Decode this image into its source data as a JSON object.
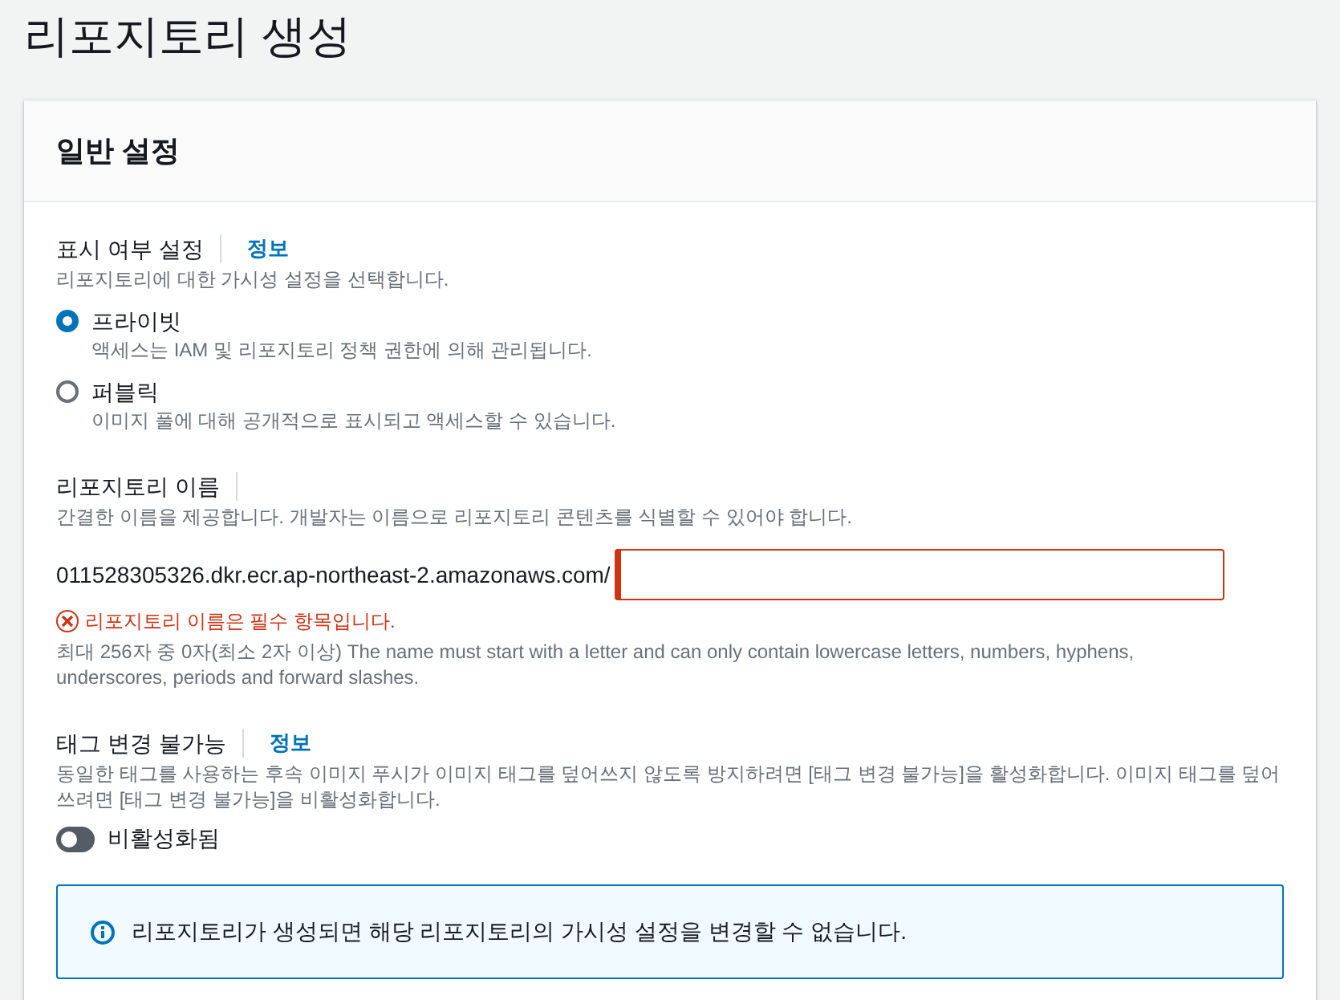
{
  "page_title": "리포지토리 생성",
  "panel": {
    "title": "일반 설정",
    "visibility": {
      "label": "표시 여부 설정",
      "info_link": "정보",
      "description": "리포지토리에 대한 가시성 설정을 선택합니다.",
      "options": [
        {
          "label": "프라이빗",
          "description": "액세스는 IAM 및 리포지토리 정책 권한에 의해 관리됩니다.",
          "selected": true
        },
        {
          "label": "퍼블릭",
          "description": "이미지 풀에 대해 공개적으로 표시되고 액세스할 수 있습니다.",
          "selected": false
        }
      ]
    },
    "repository_name": {
      "label": "리포지토리 이름",
      "description": "간결한 이름을 제공합니다. 개발자는 이름으로 리포지토리 콘텐츠를 식별할 수 있어야 합니다.",
      "prefix": "011528305326.dkr.ecr.ap-northeast-2.amazonaws.com/",
      "invalid": true,
      "error": "리포지토리 이름은 필수 항목입니다.",
      "constraint": "최대 256자 중 0자(최소 2자 이상) The name must start with a letter and can only contain lowercase letters, numbers, hyphens, underscores, periods and forward slashes."
    },
    "tag_immutability": {
      "label": "태그 변경 불가능",
      "info_link": "정보",
      "description": "동일한 태그를 사용하는 후속 이미지 푸시가 이미지 태그를 덮어쓰지 않도록 방지하려면 [태그 변경 불가능]을 활성화합니다. 이미지 태그를 덮어쓰려면 [태그 변경 불가능]을 비활성화합니다.",
      "on": false,
      "state_label": "비활성화됨"
    },
    "info_alert": "리포지토리가 생성되면 해당 리포지토리의 가시성 설정을 변경할 수 없습니다."
  }
}
